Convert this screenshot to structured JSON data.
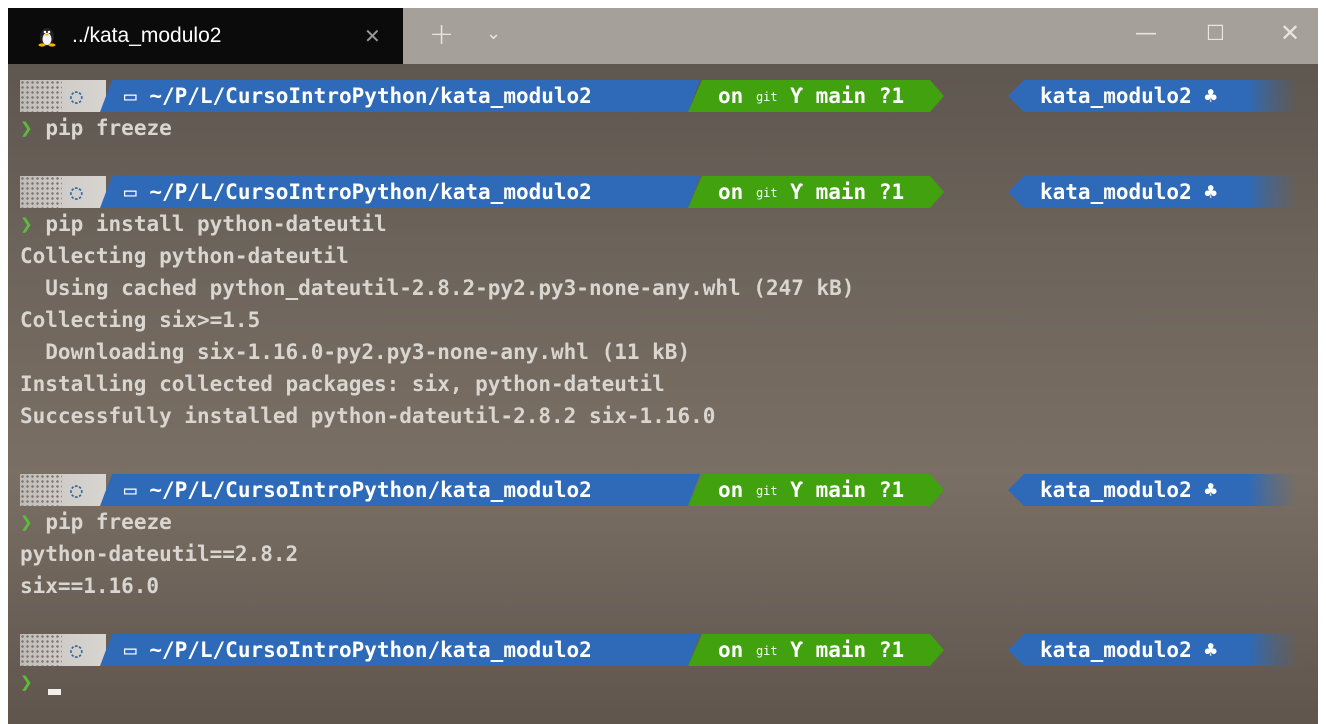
{
  "window": {
    "tab_title": "../kata_modulo2",
    "tab_icon": "linux-tux-icon",
    "close_tab_glyph": "✕",
    "new_tab_glyph": "+",
    "dropdown_glyph": "⌄",
    "minimize_glyph": "—",
    "maximize_glyph": "☐",
    "close_window_glyph": "✕"
  },
  "prompt": {
    "os_icon_glyph": "◌",
    "folder_glyph": "▭",
    "path": "~/P/L/CursoIntroPython/kata_modulo2",
    "git_on": "on",
    "git_word": "git",
    "branch_glyph": "Ƴ",
    "branch": "main ?1",
    "venv": "kata_modulo2",
    "venv_glyph": "♣",
    "caret": "❯"
  },
  "lines": {
    "cmd1": "pip freeze",
    "cmd2": "pip install python-dateutil",
    "out2": [
      "Collecting python-dateutil",
      "  Using cached python_dateutil-2.8.2-py2.py3-none-any.whl (247 kB)",
      "Collecting six>=1.5",
      "  Downloading six-1.16.0-py2.py3-none-any.whl (11 kB)",
      "Installing collected packages: six, python-dateutil",
      "Successfully installed python-dateutil-2.8.2 six-1.16.0"
    ],
    "cmd3": "pip freeze",
    "out3": [
      "python-dateutil==2.8.2",
      "six==1.16.0"
    ]
  },
  "colors": {
    "path_bg": "#2e6ab8",
    "git_bg": "#41a10f",
    "caret": "#5bbd3a"
  }
}
